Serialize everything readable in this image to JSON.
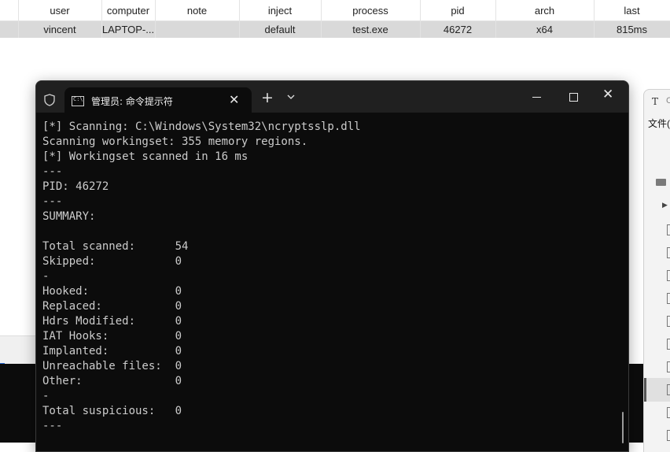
{
  "table": {
    "headers": [
      "user",
      "computer",
      "note",
      "inject",
      "process",
      "pid",
      "arch",
      "last"
    ],
    "rows": [
      [
        "vincent",
        "LAPTOP-...",
        "",
        "default",
        "test.exe",
        "46272",
        "x64",
        "815ms"
      ]
    ]
  },
  "side_window": {
    "title_glyph": "T",
    "title_fragment": "C",
    "menu_file": "文件(",
    "arrow": "▶"
  },
  "terminal": {
    "tab_title": "管理员: 命令提示符",
    "icon_text": "C:\\",
    "new_tab": "+",
    "close_tab": "✕",
    "close_window": "✕",
    "lines": [
      "[*] Scanning: C:\\Windows\\System32\\ncryptsslp.dll",
      "Scanning workingset: 355 memory regions.",
      "[*] Workingset scanned in 16 ms",
      "---",
      "PID: 46272",
      "---",
      "SUMMARY:",
      "",
      "Total scanned:      54",
      "Skipped:            0",
      "-",
      "Hooked:             0",
      "Replaced:           0",
      "Hdrs Modified:      0",
      "IAT Hooks:          0",
      "Implanted:          0",
      "Unreachable files:  0",
      "Other:              0",
      "-",
      "Total suspicious:   0",
      "---"
    ]
  },
  "colors": {
    "terminal_bg": "#0c0c0c",
    "titlebar_bg": "#202020",
    "terminal_text": "#cccccc",
    "selected_row": "#d9d9d9"
  }
}
